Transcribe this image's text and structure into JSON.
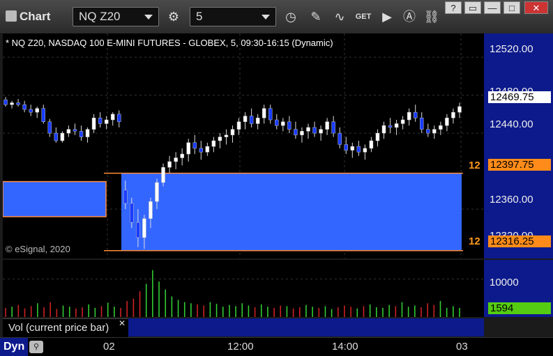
{
  "window": {
    "title": "Chart",
    "symbol": "NQ Z20",
    "interval": "5"
  },
  "legend": {
    "text": "* NQ Z20, NASDAQ 100 E-MINI FUTURES - GLOBEX, 5, 09:30-16:15 (Dynamic)"
  },
  "copyright": "© eSignal, 2020",
  "price_axis": {
    "labels": [
      "12520.00",
      "12480.00",
      "12440.00",
      "12360.00"
    ],
    "partial_label": "12320.00"
  },
  "price_tags": {
    "last": "12469.75",
    "upper": "12397.75",
    "lower": "12316.25",
    "marker": "12"
  },
  "volume": {
    "label": "Vol (current price bar)",
    "axis_label": "10000",
    "last": "1594"
  },
  "time_axis": {
    "labels": [
      "02",
      "12:00",
      "14:00",
      "03"
    ]
  },
  "footer": {
    "mode": "Dyn"
  },
  "icons": [
    "settings-gear-icon",
    "clock-icon",
    "pencil-icon",
    "indicator-icon",
    "get-icon",
    "play-icon",
    "alert-icon",
    "link-icon"
  ],
  "colors": {
    "up": "#ffffff",
    "down": "#1a3cff",
    "zone": "#3366ff",
    "zone_border": "#ff8c3a",
    "axis_bg": "#0d1a8c",
    "vol_up": "#33cc33",
    "vol_down": "#cc2222",
    "last_tag": "#55cc11"
  },
  "chart_data": {
    "type": "candlestick",
    "ylim": [
      12308,
      12545
    ],
    "visible_price_range_note": "",
    "candles": [
      [
        12475,
        12478,
        12468,
        12470
      ],
      [
        12470,
        12474,
        12466,
        12472
      ],
      [
        12472,
        12476,
        12468,
        12470
      ],
      [
        12470,
        12474,
        12462,
        12465
      ],
      [
        12465,
        12470,
        12458,
        12462
      ],
      [
        12462,
        12468,
        12456,
        12466
      ],
      [
        12466,
        12470,
        12450,
        12452
      ],
      [
        12452,
        12455,
        12436,
        12440
      ],
      [
        12440,
        12446,
        12430,
        12432
      ],
      [
        12432,
        12442,
        12430,
        12440
      ],
      [
        12440,
        12448,
        12436,
        12444
      ],
      [
        12444,
        12450,
        12438,
        12442
      ],
      [
        12442,
        12448,
        12432,
        12436
      ],
      [
        12436,
        12446,
        12430,
        12444
      ],
      [
        12444,
        12460,
        12440,
        12456
      ],
      [
        12456,
        12462,
        12446,
        12450
      ],
      [
        12450,
        12458,
        12444,
        12454
      ],
      [
        12454,
        12462,
        12448,
        12460
      ],
      [
        12460,
        12464,
        12446,
        12452
      ],
      [
        12380,
        12390,
        12360,
        12366
      ],
      [
        12366,
        12372,
        12340,
        12346
      ],
      [
        12346,
        12360,
        12320,
        12330
      ],
      [
        12330,
        12354,
        12318,
        12350
      ],
      [
        12350,
        12372,
        12340,
        12368
      ],
      [
        12368,
        12392,
        12360,
        12388
      ],
      [
        12388,
        12408,
        12384,
        12404
      ],
      [
        12404,
        12416,
        12398,
        12410
      ],
      [
        12410,
        12420,
        12402,
        12414
      ],
      [
        12414,
        12424,
        12406,
        12418
      ],
      [
        12418,
        12434,
        12410,
        12430
      ],
      [
        12430,
        12438,
        12418,
        12424
      ],
      [
        12424,
        12432,
        12412,
        12420
      ],
      [
        12420,
        12430,
        12416,
        12426
      ],
      [
        12426,
        12436,
        12420,
        12432
      ],
      [
        12432,
        12440,
        12424,
        12436
      ],
      [
        12436,
        12444,
        12428,
        12438
      ],
      [
        12438,
        12448,
        12430,
        12444
      ],
      [
        12444,
        12456,
        12438,
        12452
      ],
      [
        12452,
        12462,
        12444,
        12458
      ],
      [
        12458,
        12466,
        12446,
        12450
      ],
      [
        12450,
        12460,
        12444,
        12456
      ],
      [
        12456,
        12470,
        12450,
        12466
      ],
      [
        12466,
        12470,
        12450,
        12454
      ],
      [
        12454,
        12460,
        12444,
        12448
      ],
      [
        12448,
        12456,
        12442,
        12452
      ],
      [
        12452,
        12458,
        12440,
        12444
      ],
      [
        12444,
        12452,
        12434,
        12438
      ],
      [
        12438,
        12446,
        12430,
        12442
      ],
      [
        12442,
        12450,
        12434,
        12446
      ],
      [
        12446,
        12452,
        12436,
        12440
      ],
      [
        12440,
        12448,
        12432,
        12444
      ],
      [
        12444,
        12456,
        12438,
        12452
      ],
      [
        12452,
        12458,
        12436,
        12440
      ],
      [
        12440,
        12446,
        12424,
        12428
      ],
      [
        12428,
        12436,
        12418,
        12422
      ],
      [
        12422,
        12430,
        12414,
        12426
      ],
      [
        12426,
        12432,
        12416,
        12420
      ],
      [
        12420,
        12428,
        12412,
        12424
      ],
      [
        12424,
        12436,
        12420,
        12432
      ],
      [
        12432,
        12444,
        12426,
        12440
      ],
      [
        12440,
        12452,
        12434,
        12448
      ],
      [
        12448,
        12456,
        12440,
        12446
      ],
      [
        12446,
        12454,
        12438,
        12450
      ],
      [
        12450,
        12458,
        12444,
        12454
      ],
      [
        12454,
        12466,
        12448,
        12462
      ],
      [
        12462,
        12470,
        12452,
        12456
      ],
      [
        12456,
        12462,
        12440,
        12444
      ],
      [
        12444,
        12450,
        12436,
        12440
      ],
      [
        12440,
        12448,
        12434,
        12444
      ],
      [
        12444,
        12452,
        12438,
        12448
      ],
      [
        12448,
        12460,
        12442,
        12456
      ],
      [
        12456,
        12466,
        12450,
        12462
      ],
      [
        12462,
        12472,
        12456,
        12468
      ]
    ],
    "volume_values": [
      1600,
      1800,
      2100,
      1500,
      1900,
      2400,
      1700,
      2600,
      1400,
      2000,
      1800,
      1500,
      1700,
      2200,
      1600,
      1900,
      2500,
      1800,
      1600,
      2800,
      3200,
      4500,
      5800,
      8200,
      6200,
      4800,
      3600,
      3000,
      2600,
      2400,
      2200,
      2000,
      2600,
      2300,
      1800,
      2100,
      1900,
      2400,
      2000,
      1700,
      2200,
      1800,
      1600,
      2000,
      1900,
      1500,
      1700,
      2100,
      1800,
      1600,
      1900,
      1400,
      1700,
      2000,
      1800,
      1500,
      1900,
      2200,
      1700,
      1600,
      2100,
      1900,
      2600,
      1800,
      2000,
      1700,
      2400,
      2100,
      2800,
      1600,
      1900,
      1594
    ]
  }
}
